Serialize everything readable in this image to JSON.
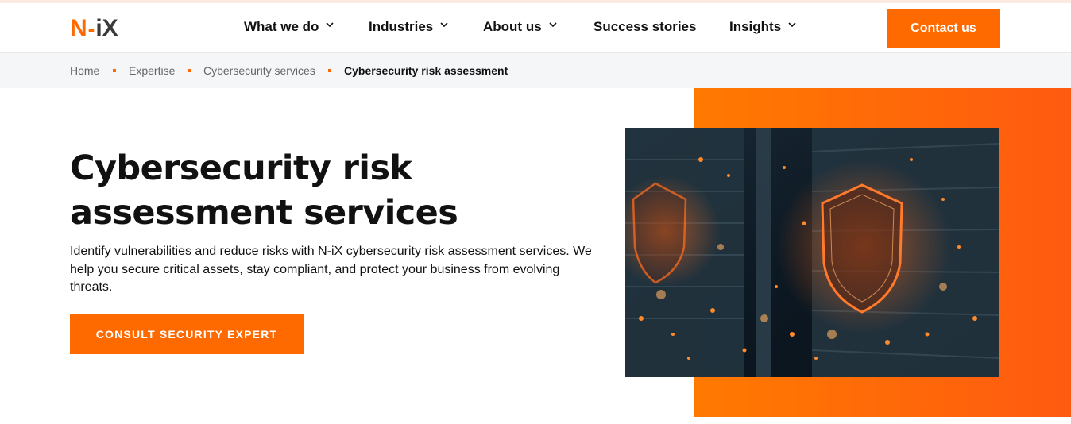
{
  "brand": {
    "logo_n": "N",
    "logo_dash": "-",
    "logo_ix": "iX",
    "accent_color": "#ff6a00"
  },
  "nav": {
    "items": [
      {
        "label": "What we do",
        "has_dropdown": true
      },
      {
        "label": "Industries",
        "has_dropdown": true
      },
      {
        "label": "About us",
        "has_dropdown": true
      },
      {
        "label": "Success stories",
        "has_dropdown": false
      },
      {
        "label": "Insights",
        "has_dropdown": true
      }
    ],
    "contact_label": "Contact us"
  },
  "breadcrumb": {
    "items": [
      "Home",
      "Expertise",
      "Cybersecurity services"
    ],
    "current": "Cybersecurity risk assessment"
  },
  "hero": {
    "title_line1": "Cybersecurity risk",
    "title_line2": "assessment services",
    "lead_line1": "Identify vulnerabilities and reduce risks with N-iX cybersecurity risk assessment services. We",
    "lead_line2": "help you secure critical assets, stay compliant, and protect your business from evolving",
    "lead_line3": "threats.",
    "cta_label": "CONSULT SECURITY EXPERT",
    "image_icon": "shield-icon"
  }
}
